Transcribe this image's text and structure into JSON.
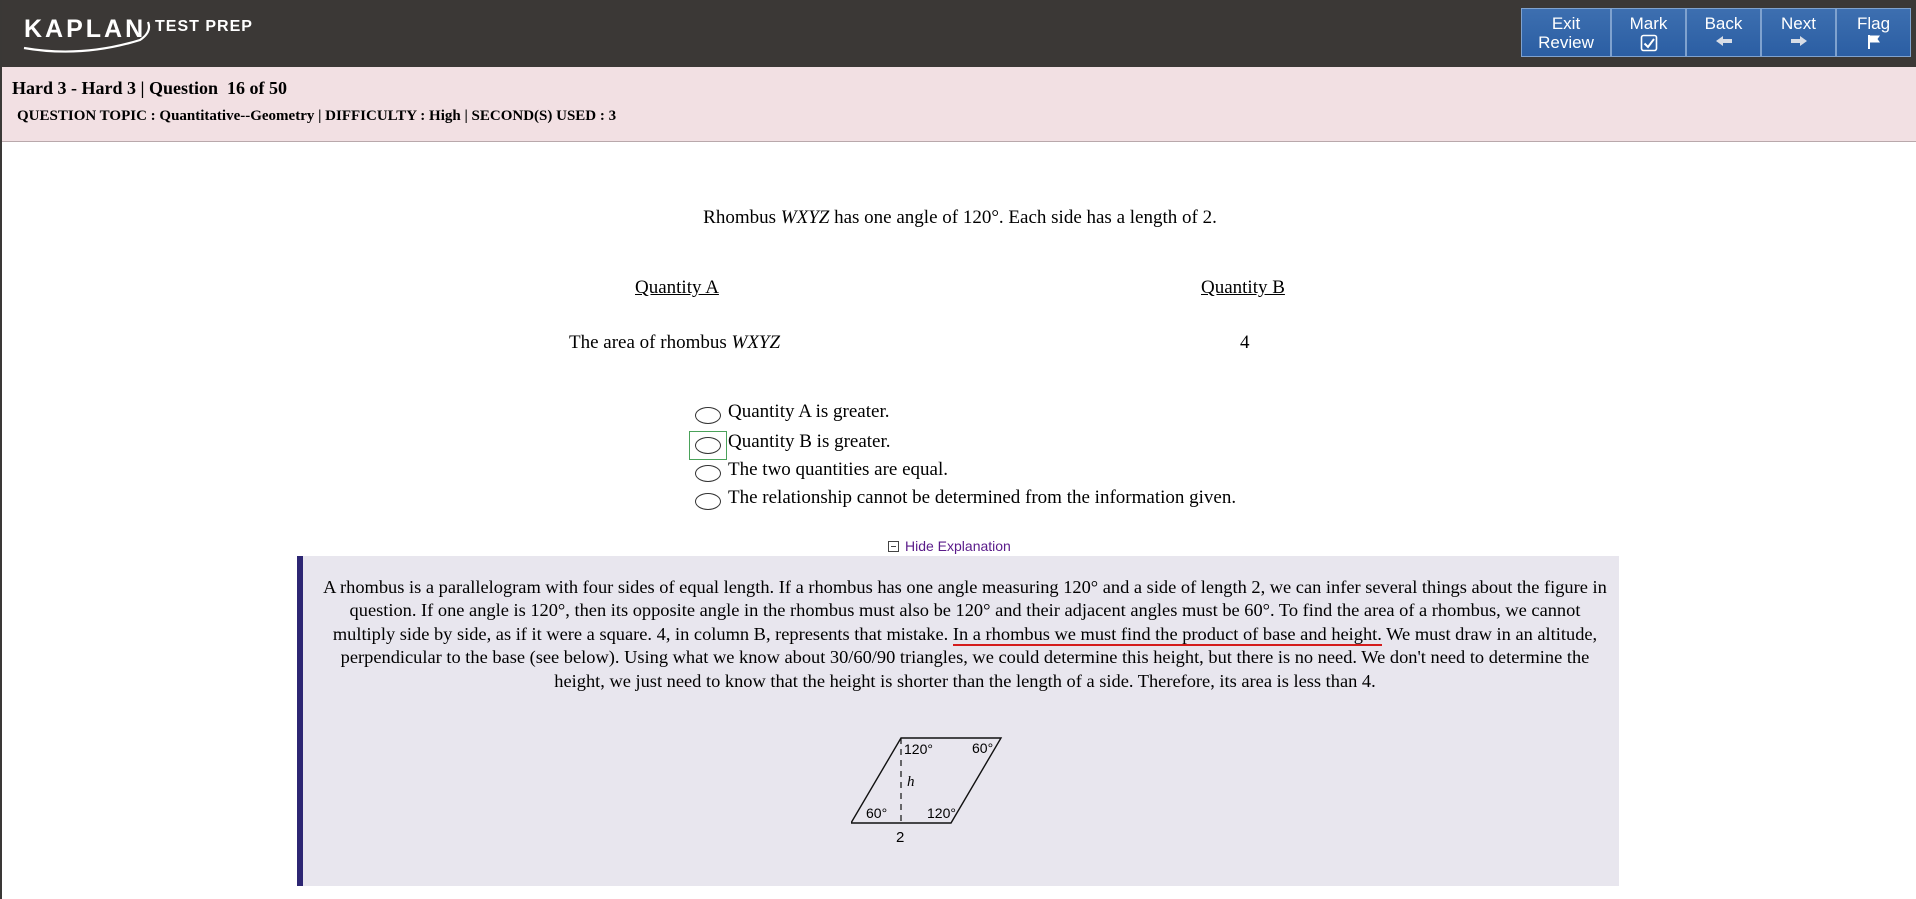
{
  "header": {
    "logo": {
      "brand": "KAPLAN",
      "product": "TEST PREP"
    },
    "buttons": [
      {
        "label_line1": "Exit",
        "label_line2": "Review",
        "icon": "none"
      },
      {
        "label_line1": "Mark",
        "icon": "checkbox-checked-icon"
      },
      {
        "label_line1": "Back",
        "icon": "arrow-left-icon"
      },
      {
        "label_line1": "Next",
        "icon": "arrow-right-icon"
      },
      {
        "label_line1": "Flag",
        "icon": "flag-icon"
      }
    ]
  },
  "info": {
    "title": "Hard 3 - Hard 3 | Question  16 of 50",
    "meta": "QUESTION TOPIC : Quantitative--Geometry | DIFFICULTY : High | SECOND(S) USED : 3"
  },
  "question": {
    "stem_prefix": "Rhombus ",
    "stem_var": "WXYZ",
    "stem_suffix": " has one angle of 120°. Each side has a length of 2.",
    "quantity_a_heading": "Quantity A",
    "quantity_b_heading": "Quantity B",
    "quantity_a_prefix": "The area of rhombus ",
    "quantity_a_var": "WXYZ",
    "quantity_b_value": "4",
    "choices": [
      "Quantity A is greater.",
      "Quantity B is greater.",
      "The two quantities are equal.",
      "The relationship cannot be determined from the information given."
    ]
  },
  "explanation": {
    "toggle_label": "Hide Explanation",
    "text_part1": "A rhombus is a parallelogram with four sides of equal length. If a rhombus has one angle measuring 120° and a side of length 2, we can infer several things about the figure in question. If one angle is 120°, then its opposite angle in the rhombus must also be 120° and their adjacent angles must be 60°. To find the area of a rhombus, we cannot multiply side by side, as if it were a square. 4, in column B, represents that mistake. ",
    "text_underlined": "In a rhombus we must find the product of base and height.",
    "text_part2": " We must draw in an altitude, perpendicular to the base (see below). Using what we know about 30/60/90 triangles, we could determine this height, but there is no need. We don't need to determine the height, we just need to know that the height is shorter than the length of a side. Therefore, its area is less than 4.",
    "figure": {
      "angle_top_left": "120°",
      "angle_top_right": "60°",
      "angle_bottom_left": "60°",
      "angle_bottom_right": "120°",
      "height_label": "h",
      "base_label": "2"
    }
  },
  "colors": {
    "topbar": "#3b3836",
    "nav_button": "#2f62a6",
    "info_bar": "#f2e0e3",
    "explanation_bg": "#e8e6ee",
    "explanation_border": "#2d2673",
    "annotation_red": "#d41c1c",
    "toggle_link": "#5a1b8a"
  }
}
